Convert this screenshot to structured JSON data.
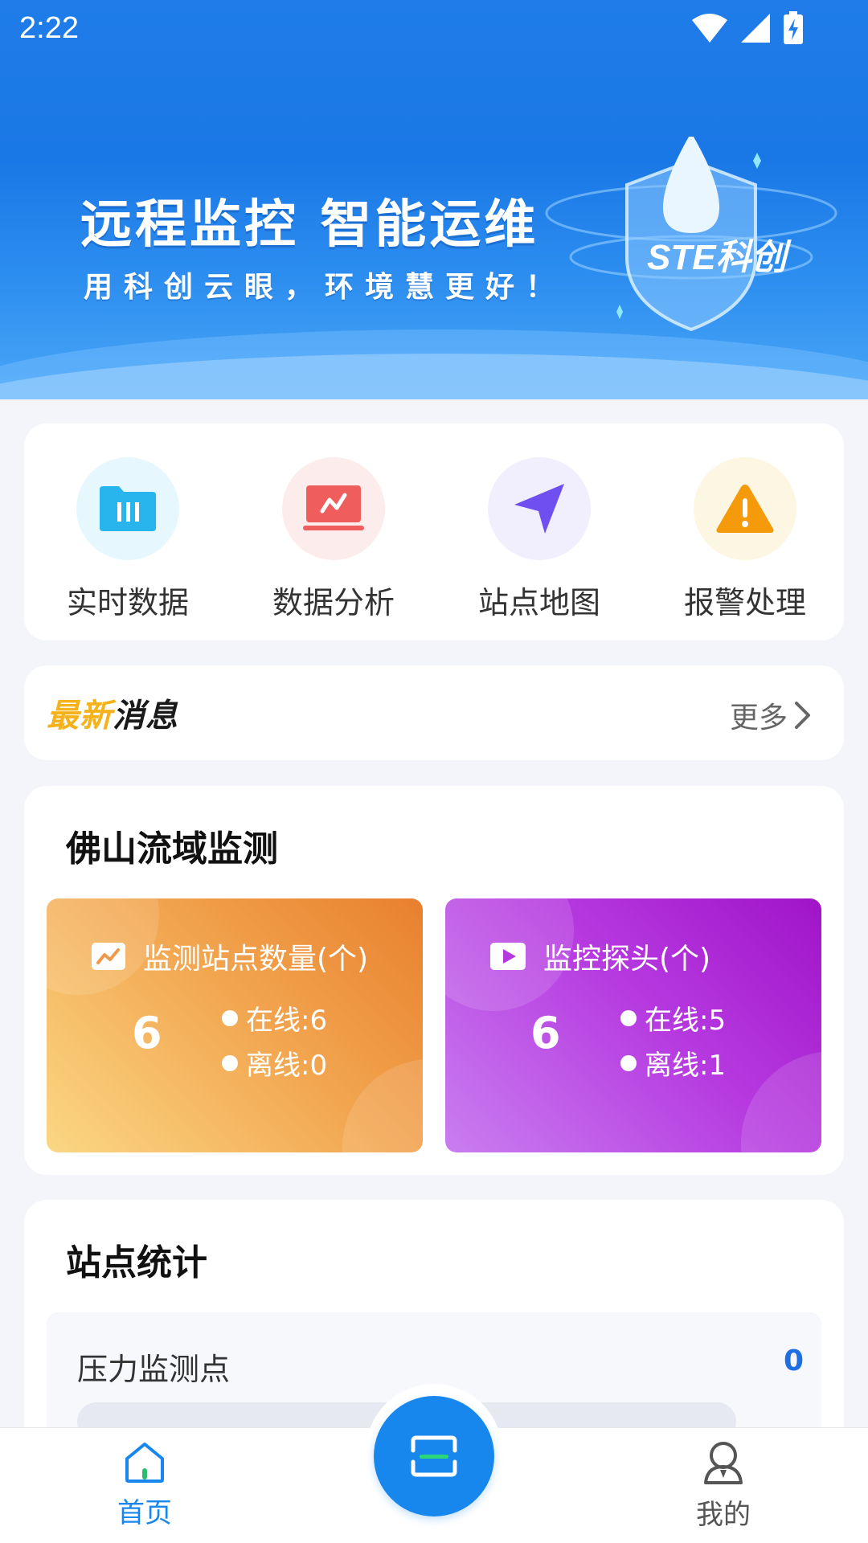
{
  "status_bar": {
    "time": "2:22"
  },
  "banner": {
    "title": "远程监控 智能运维",
    "subtitle": "用科创云眼，环境慧更好！",
    "logo_text": "STE科创"
  },
  "menu": [
    {
      "label": "实时数据",
      "icon": "folder-data-icon",
      "circle_color": "#e6f7fd",
      "icon_color": "#28b5ee"
    },
    {
      "label": "数据分析",
      "icon": "chart-screen-icon",
      "circle_color": "#fdecec",
      "icon_color": "#ef5d5d"
    },
    {
      "label": "站点地图",
      "icon": "navigation-arrow-icon",
      "circle_color": "#f1effd",
      "icon_color": "#6f4ff0"
    },
    {
      "label": "报警处理",
      "icon": "warning-icon",
      "circle_color": "#fdf6e3",
      "icon_color": "#f59a0b"
    }
  ],
  "news": {
    "title_highlight": "最新",
    "title_rest": "消息",
    "more_label": "更多"
  },
  "monitoring": {
    "title": "佛山流域监测",
    "stations": {
      "label": "监测站点数量(个)",
      "count": "6",
      "online": "在线:6",
      "offline": "离线:0"
    },
    "cameras": {
      "label": "监控探头(个)",
      "count": "6",
      "online": "在线:5",
      "offline": "离线:1"
    }
  },
  "site_stats": {
    "title": "站点统计",
    "rows": [
      {
        "label": "压力监测点",
        "value": "0",
        "progress": 0
      }
    ]
  },
  "bottom_nav": {
    "home_label": "首页",
    "profile_label": "我的",
    "active_color": "#1787ee",
    "inactive_color": "#555555"
  }
}
